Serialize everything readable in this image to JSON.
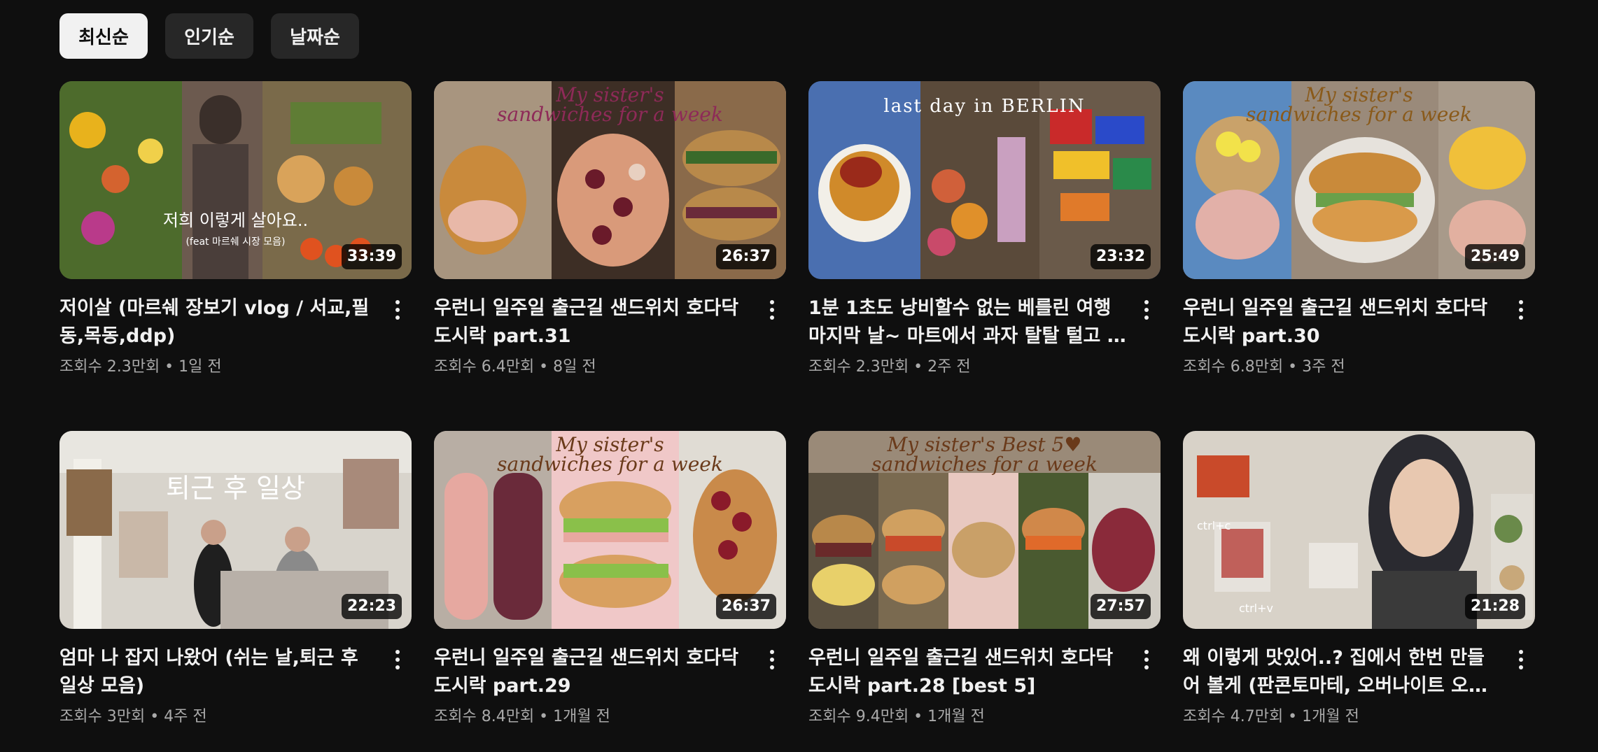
{
  "chips": [
    {
      "label": "최신순",
      "active": true
    },
    {
      "label": "인기순",
      "active": false
    },
    {
      "label": "날짜순",
      "active": false
    }
  ],
  "videos": [
    {
      "title": "저이살 (마르쉐 장보기 vlog / 서교,필동,목동,ddp)",
      "views": "조회수 2.3만회",
      "age": "1일 전",
      "duration": "33:39",
      "thumb_text": "저희 이렇게 살아요..",
      "thumb_subtext": "(feat 마르쉐 시장 모음)"
    },
    {
      "title": "우런니 일주일 출근길 샌드위치 호다닥 도시락 part.31",
      "views": "조회수 6.4만회",
      "age": "8일 전",
      "duration": "26:37",
      "thumb_text": "My sister's",
      "thumb_subtext": "sandwiches for a week"
    },
    {
      "title": "1분 1초도 낭비할수 없는 베를린 여행 마지막 날~ 마트에서 과자 탈탈 털고 …",
      "views": "조회수 2.3만회",
      "age": "2주 전",
      "duration": "23:32",
      "thumb_text": "last day in BERLIN",
      "thumb_subtext": ""
    },
    {
      "title": "우런니 일주일 출근길 샌드위치 호다닥 도시락 part.30",
      "views": "조회수 6.8만회",
      "age": "3주 전",
      "duration": "25:49",
      "thumb_text": "My sister's",
      "thumb_subtext": "sandwiches for a week"
    },
    {
      "title": "엄마 나 잡지 나왔어 (쉬는 날,퇴근 후 일상 모음)",
      "views": "조회수 3만회",
      "age": "4주 전",
      "duration": "22:23",
      "thumb_text": "퇴근 후 일상",
      "thumb_subtext": ""
    },
    {
      "title": "우런니 일주일 출근길 샌드위치 호다닥 도시락 part.29",
      "views": "조회수 8.4만회",
      "age": "1개월 전",
      "duration": "26:37",
      "thumb_text": "My sister's",
      "thumb_subtext": "sandwiches for a week"
    },
    {
      "title": "우런니 일주일 출근길 샌드위치 호다닥 도시락 part.28 [best 5]",
      "views": "조회수 9.4만회",
      "age": "1개월 전",
      "duration": "27:57",
      "thumb_text": "My sister's Best 5♥",
      "thumb_subtext": "sandwiches for a week"
    },
    {
      "title": "왜 이렇게 맛있어..? 집에서 한번 만들어 볼게 (판콘토마테, 오버나이트 오트밀,…",
      "views": "조회수 4.7만회",
      "age": "1개월 전",
      "duration": "21:28",
      "thumb_text": "ctrl+c",
      "thumb_subtext": "ctrl+v"
    }
  ],
  "colors": {
    "background": "#0f0f0f",
    "chip_bg": "#272727",
    "chip_active_bg": "#f1f1f1",
    "text_primary": "#f1f1f1",
    "text_secondary": "#aaaaaa",
    "caption_pink": "#8e2a58"
  },
  "icons": {
    "more": "vertical-ellipsis-icon"
  }
}
